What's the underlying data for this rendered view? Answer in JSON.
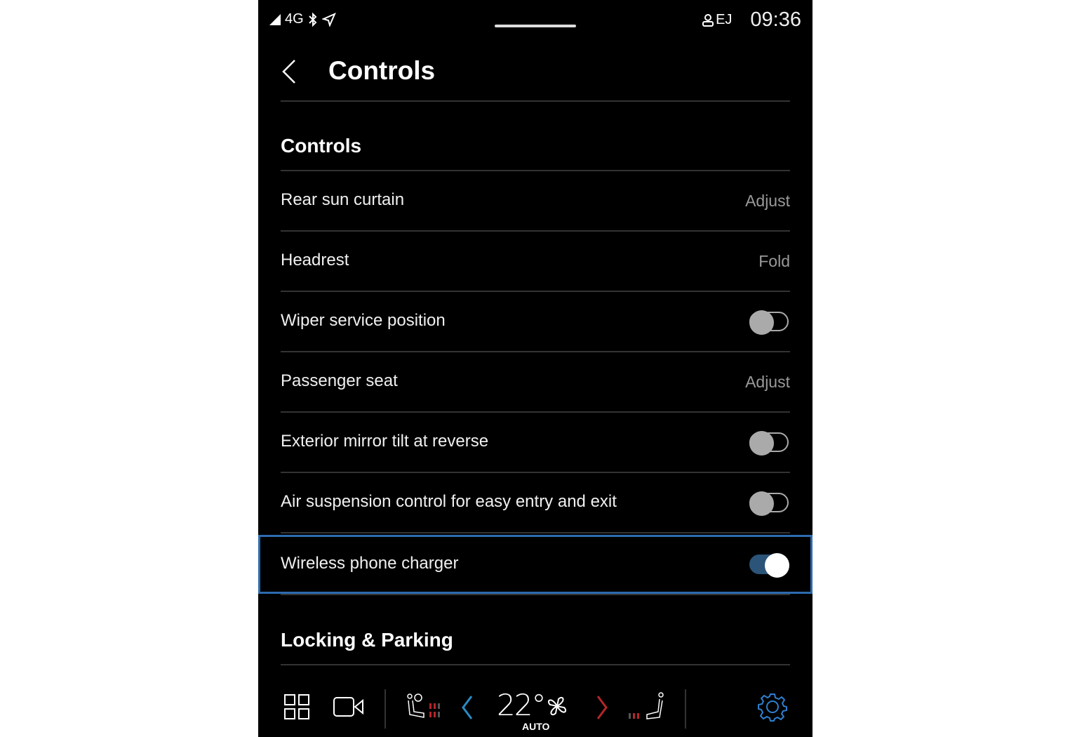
{
  "status_bar": {
    "network": "4G",
    "icons": [
      "signal-icon",
      "bluetooth-icon",
      "location-icon"
    ],
    "profile": "EJ",
    "time": "09:36"
  },
  "header": {
    "title": "Controls",
    "back_icon": "chevron-left-icon"
  },
  "sections": [
    {
      "title": "Controls",
      "rows": [
        {
          "label": "Rear sun curtain",
          "type": "action",
          "value": "Adjust"
        },
        {
          "label": "Headrest",
          "type": "action",
          "value": "Fold"
        },
        {
          "label": "Wiper service position",
          "type": "toggle",
          "on": false
        },
        {
          "label": "Passenger seat",
          "type": "action",
          "value": "Adjust"
        },
        {
          "label": "Exterior mirror tilt at reverse",
          "type": "toggle",
          "on": false
        },
        {
          "label": "Air suspension control for easy entry and exit",
          "type": "toggle",
          "on": false
        },
        {
          "label": "Wireless phone charger",
          "type": "toggle",
          "on": true,
          "focused": true
        }
      ]
    },
    {
      "title": "Locking & Parking",
      "rows": []
    }
  ],
  "climate_bar": {
    "temperature": "22°",
    "mode": "AUTO",
    "icons": [
      "home-grid-icon",
      "camera-icon",
      "driver-seat-heat-icon",
      "temp-down-icon",
      "fan-icon",
      "temp-up-icon",
      "passenger-seat-heat-icon",
      "settings-gear-icon"
    ]
  },
  "colors": {
    "accent": "#2d6bb0",
    "toggle_on_track": "#2b5478",
    "heat_red": "#b3262a",
    "temp_down_blue": "#2a8bc2"
  }
}
